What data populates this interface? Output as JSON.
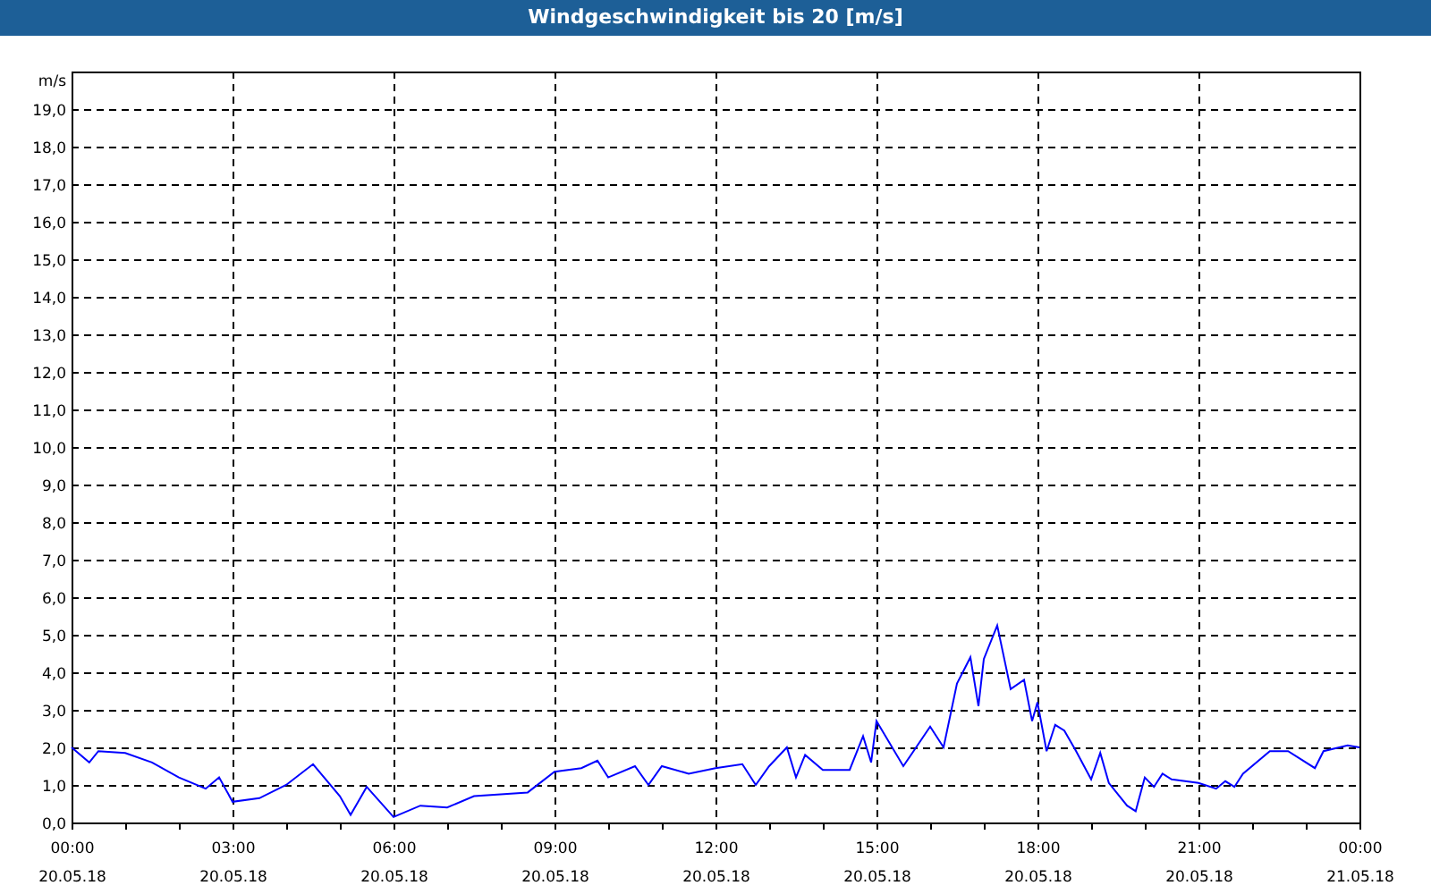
{
  "window": {
    "title": "Windgeschwindigkeit bis 20 [m/s]"
  },
  "chart": {
    "chart_data": {
      "type": "line",
      "grid": true,
      "ylabel": "m/s",
      "xlim": [
        0,
        24
      ],
      "ylim": [
        0,
        20
      ],
      "xticks": [
        {
          "value": 0,
          "label": "00:00"
        },
        {
          "value": 3,
          "label": "03:00"
        },
        {
          "value": 6,
          "label": "06:00"
        },
        {
          "value": 9,
          "label": "09:00"
        },
        {
          "value": 12,
          "label": "12:00"
        },
        {
          "value": 15,
          "label": "15:00"
        },
        {
          "value": 18,
          "label": "18:00"
        },
        {
          "value": 21,
          "label": "21:00"
        },
        {
          "value": 24,
          "label": "00:00"
        }
      ],
      "yticks": [
        {
          "value": 0,
          "label": "0,0"
        },
        {
          "value": 1,
          "label": "1,0"
        },
        {
          "value": 2,
          "label": "2,0"
        },
        {
          "value": 3,
          "label": "3,0"
        },
        {
          "value": 4,
          "label": "4,0"
        },
        {
          "value": 5,
          "label": "5,0"
        },
        {
          "value": 6,
          "label": "6,0"
        },
        {
          "value": 7,
          "label": "7,0"
        },
        {
          "value": 8,
          "label": "8,0"
        },
        {
          "value": 9,
          "label": "9,0"
        },
        {
          "value": 10,
          "label": "10,0"
        },
        {
          "value": 11,
          "label": "11,0"
        },
        {
          "value": 12,
          "label": "12,0"
        },
        {
          "value": 13,
          "label": "13,0"
        },
        {
          "value": 14,
          "label": "14,0"
        },
        {
          "value": 15,
          "label": "15,0"
        },
        {
          "value": 16,
          "label": "16,0"
        },
        {
          "value": 17,
          "label": "17,0"
        },
        {
          "value": 18,
          "label": "18,0"
        },
        {
          "value": 19,
          "label": "19,0"
        }
      ],
      "x": [
        0,
        0.33,
        0.5,
        1,
        1.5,
        2,
        2.5,
        2.75,
        3,
        3.5,
        4,
        4.5,
        5,
        5.2,
        5.5,
        6,
        6.5,
        7,
        7.5,
        8,
        8.5,
        9,
        9.5,
        9.8,
        10,
        10.5,
        10.75,
        11,
        11.5,
        12,
        12.5,
        12.75,
        13,
        13.33,
        13.5,
        13.67,
        14,
        14.5,
        14.75,
        14.9,
        15,
        15.5,
        16,
        16.25,
        16.5,
        16.75,
        16.9,
        17,
        17.25,
        17.5,
        17.75,
        17.9,
        18,
        18.17,
        18.33,
        18.5,
        18.72,
        19,
        19.17,
        19.33,
        19.67,
        19.83,
        20,
        20.17,
        20.33,
        20.5,
        21,
        21.33,
        21.5,
        21.67,
        21.83,
        22.33,
        22.67,
        23.17,
        23.33,
        23.78,
        24
      ],
      "series": [
        {
          "color": "#0000ff",
          "values": [
            2.0,
            1.6,
            1.9,
            1.85,
            1.6,
            1.2,
            0.9,
            1.2,
            0.55,
            0.65,
            1.0,
            1.55,
            0.7,
            0.2,
            0.95,
            0.15,
            0.45,
            0.4,
            0.7,
            0.75,
            0.8,
            1.35,
            1.45,
            1.65,
            1.2,
            1.5,
            1.0,
            1.5,
            1.3,
            1.45,
            1.55,
            1.0,
            1.5,
            2.0,
            1.2,
            1.8,
            1.4,
            1.4,
            2.3,
            1.6,
            2.7,
            1.5,
            2.55,
            2.0,
            3.7,
            4.4,
            3.1,
            4.35,
            5.25,
            3.55,
            3.8,
            2.7,
            3.2,
            1.9,
            2.6,
            2.45,
            1.9,
            1.15,
            1.85,
            1.05,
            0.45,
            0.3,
            1.2,
            0.95,
            1.3,
            1.15,
            1.05,
            0.9,
            1.1,
            0.95,
            1.3,
            1.9,
            1.9,
            1.45,
            1.9,
            2.05,
            2.0
          ]
        }
      ]
    },
    "x_tick_dates": [
      "20.05.18",
      "20.05.18",
      "20.05.18",
      "20.05.18",
      "20.05.18",
      "20.05.18",
      "20.05.18",
      "20.05.18",
      "21.05.18"
    ]
  }
}
